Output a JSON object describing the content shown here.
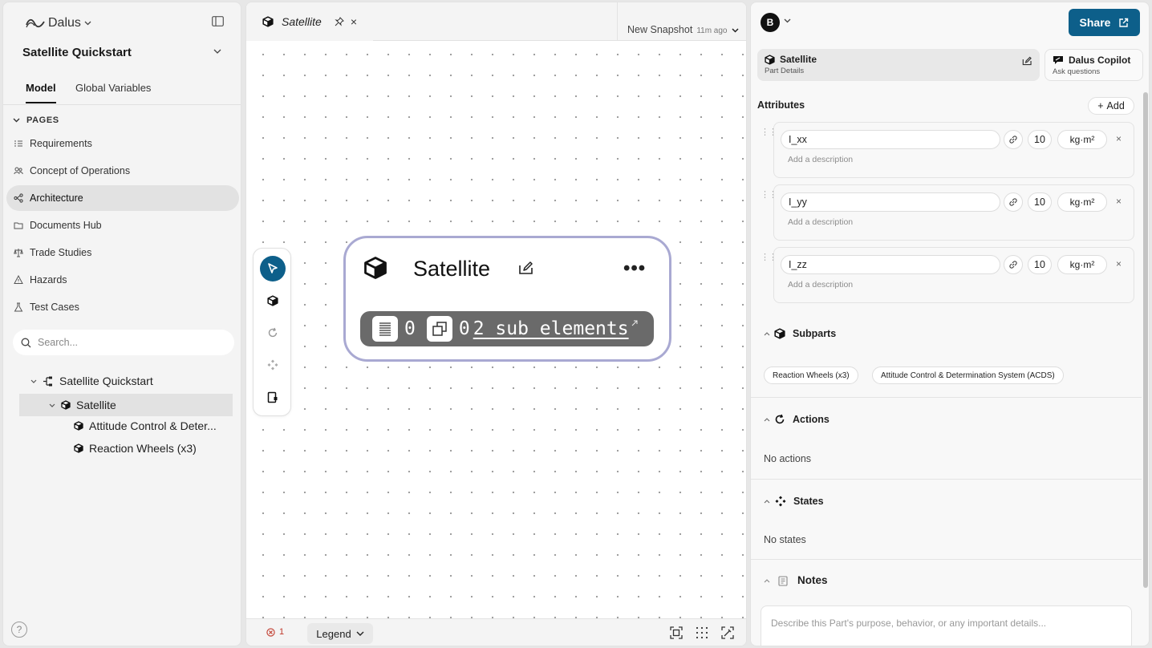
{
  "app": {
    "logo_text": "Dalus"
  },
  "sidebar": {
    "project_title": "Satellite Quickstart",
    "tabs": [
      "Model",
      "Global Variables"
    ],
    "pages_label": "PAGES",
    "pages": [
      "Requirements",
      "Concept of Operations",
      "Architecture",
      "Documents Hub",
      "Trade Studies",
      "Hazards",
      "Test Cases"
    ],
    "active_page": "Architecture",
    "search_placeholder": "Search...",
    "tree": [
      {
        "label": "Satellite Quickstart",
        "level": 0,
        "icon": "hierarchy-icon"
      },
      {
        "label": "Satellite",
        "level": 1,
        "icon": "cube-icon",
        "selected": true
      },
      {
        "label": "Attitude Control & Deter...",
        "level": 2,
        "icon": "cube-icon"
      },
      {
        "label": "Reaction Wheels (x3)",
        "level": 2,
        "icon": "cube-icon"
      }
    ],
    "help_label": "?"
  },
  "canvas": {
    "tab_title": "Satellite",
    "close_glyph": "×",
    "snapshot_label": "New Snapshot",
    "snapshot_time": "11m ago",
    "node": {
      "title": "Satellite",
      "more_glyph": "•••",
      "req_count": "0",
      "instance_count": "0",
      "sub_elements_label": "2 sub elements"
    },
    "error_count": "1",
    "legend_label": "Legend"
  },
  "panel": {
    "avatar_initial": "B",
    "share_label": "Share",
    "tab_part_title": "Satellite",
    "tab_part_sub": "Part Details",
    "tab_copilot_title": "Dalus Copilot",
    "tab_copilot_sub": "Ask questions",
    "attributes_label": "Attributes",
    "add_label": "Add",
    "add_glyph": "+",
    "remove_glyph": "×",
    "attributes": [
      {
        "name": "I_xx",
        "value": "10",
        "unit": "kg·m²",
        "desc_placeholder": "Add a description"
      },
      {
        "name": "I_yy",
        "value": "10",
        "unit": "kg·m²",
        "desc_placeholder": "Add a description"
      },
      {
        "name": "I_zz",
        "value": "10",
        "unit": "kg·m²",
        "desc_placeholder": "Add a description"
      }
    ],
    "subparts_label": "Subparts",
    "subparts": [
      "Reaction Wheels (x3)",
      "Attitude Control & Determination System (ACDS)"
    ],
    "actions_label": "Actions",
    "actions_empty": "No actions",
    "states_label": "States",
    "states_empty": "No states",
    "notes_label": "Notes",
    "notes_placeholder": "Describe this Part's purpose, behavior, or any important details...",
    "colors": {
      "accent": "#0d5f8a",
      "node_border": "#a9a9d2",
      "error": "#c0392b"
    }
  }
}
